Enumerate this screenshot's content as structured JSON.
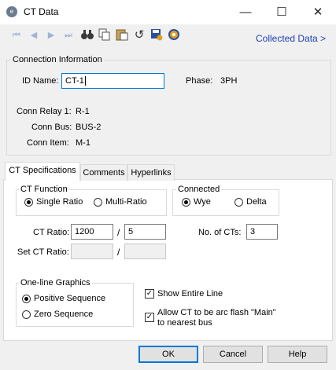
{
  "window": {
    "title": "CT Data",
    "minimize": "—",
    "maximize": "☐",
    "close": "✕",
    "app_icon": "e"
  },
  "toolbar": {
    "icons": [
      "first-icon",
      "prev-icon",
      "next-icon",
      "last-icon",
      "find-icon",
      "copy-icon",
      "paste-icon",
      "undo-icon",
      "save-icon",
      "settings-icon"
    ],
    "collected_link": "Collected Data >"
  },
  "connection": {
    "group_label": "Connection Information",
    "id_label": "ID Name:",
    "id_value": "CT-1",
    "phase_label": "Phase:",
    "phase_value": "3PH",
    "relay_label": "Conn Relay 1:",
    "relay_value": "R-1",
    "bus_label": "Conn Bus:",
    "bus_value": "BUS-2",
    "item_label": "Conn Item:",
    "item_value": "M-1"
  },
  "tabs": [
    "CT Specifications",
    "Comments",
    "Hyperlinks"
  ],
  "ct_function": {
    "label": "CT Function",
    "options": [
      "Single Ratio",
      "Multi-Ratio"
    ],
    "selected": "Single Ratio"
  },
  "connected": {
    "label": "Connected",
    "options": [
      "Wye",
      "Delta"
    ],
    "selected": "Wye"
  },
  "ratio": {
    "ct_ratio_label": "CT Ratio:",
    "primary": "1200",
    "slash": "/",
    "secondary": "5",
    "set_ratio_label": "Set CT Ratio:",
    "set_primary": "",
    "set_secondary": "",
    "num_cts_label": "No. of CTs:",
    "num_cts": "3"
  },
  "oneline": {
    "label": "One-line Graphics",
    "options": [
      "Positive Sequence",
      "Zero Sequence"
    ],
    "selected": "Positive Sequence"
  },
  "checks": {
    "show_entire_line": "Show Entire Line",
    "arc_flash_line1": "Allow CT to be arc flash \"Main\"",
    "arc_flash_line2": "to nearest bus"
  },
  "buttons": {
    "ok": "OK",
    "cancel": "Cancel",
    "help": "Help"
  }
}
